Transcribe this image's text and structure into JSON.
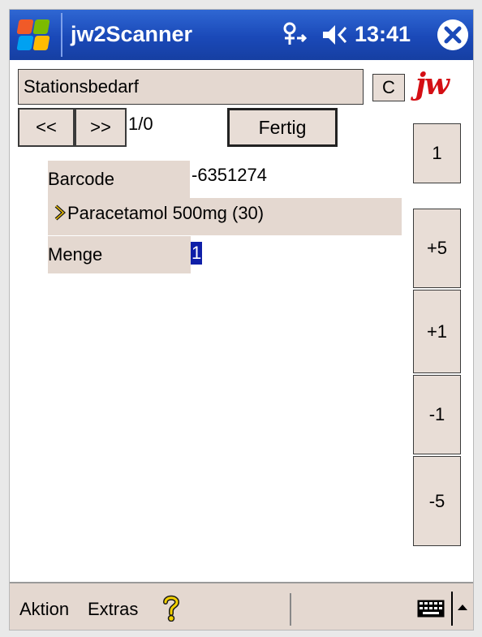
{
  "titlebar": {
    "app_title": "jw2Scanner",
    "time": "13:41",
    "start_icon": "windows-flag-icon",
    "connectivity_icon": "connectivity-icon",
    "volume_icon": "speaker-muted-icon",
    "close_icon": "close-icon"
  },
  "form": {
    "station_value": "Stationsbedarf",
    "clear_label": "C",
    "logo_text": "jw",
    "prev_label": "<<",
    "next_label": ">>",
    "counter": "1/0",
    "fertig_label": "Fertig",
    "barcode_label": "Barcode",
    "barcode_value": "-6351274",
    "product": "Paracetamol 500mg (30)",
    "menge_label": "Menge",
    "menge_value": "1"
  },
  "side_buttons": {
    "one": "1",
    "plus5": "+5",
    "plus1": "+1",
    "minus1": "-1",
    "minus5": "-5"
  },
  "menubar": {
    "aktion": "Aktion",
    "extras": "Extras",
    "help_icon": "help-question-icon",
    "keyboard_icon": "keyboard-icon"
  },
  "colors": {
    "titlebar": "#1a49b8",
    "button_bg": "#e8ddd6",
    "selection": "#0f1fa8",
    "logo_red": "#d40f14"
  }
}
